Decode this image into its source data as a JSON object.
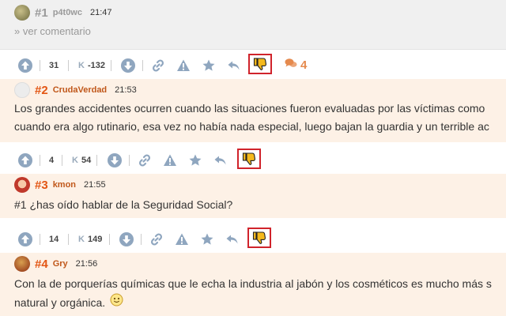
{
  "comments": [
    {
      "number": "#1",
      "user": "p4t0wc",
      "time": "21:47",
      "link": "» ver comentario"
    },
    {
      "number": "#2",
      "user": "CrudaVerdad",
      "time": "21:53",
      "lines": [
        "Los grandes accidentes ocurren cuando las situaciones fueron evaluadas por las víctimas como",
        "cuando era algo rutinario, esa vez no había nada especial, luego bajan la guardia y un terrible ac"
      ]
    },
    {
      "number": "#3",
      "user": "kmon",
      "time": "21:55",
      "lines": [
        "#1 ¿has oído hablar de la Seguridad Social?"
      ]
    },
    {
      "number": "#4",
      "user": "Gry",
      "time": "21:56",
      "lines": [
        "Con la de porquerías químicas que le echa la industria al jabón y los cosméticos es mucho más s",
        "natural y orgánica."
      ]
    }
  ],
  "vote_bars": [
    {
      "votes": "31",
      "karma_label": "K",
      "karma": "-132",
      "comments_count": "4"
    },
    {
      "votes": "4",
      "karma_label": "K",
      "karma": "54"
    },
    {
      "votes": "14",
      "karma_label": "K",
      "karma": "149"
    }
  ],
  "colors": {
    "accent": "#e35614",
    "highlight": "#d0232b",
    "icon": "#8fa6bf",
    "thumb": "#f5b91c",
    "comment_bg": "#fdf1e6"
  },
  "icons": [
    "arrow-up-icon",
    "arrow-down-icon",
    "link-icon",
    "warning-icon",
    "star-icon",
    "reply-icon",
    "thumbs-down-icon",
    "comments-icon",
    "smiley-icon"
  ]
}
